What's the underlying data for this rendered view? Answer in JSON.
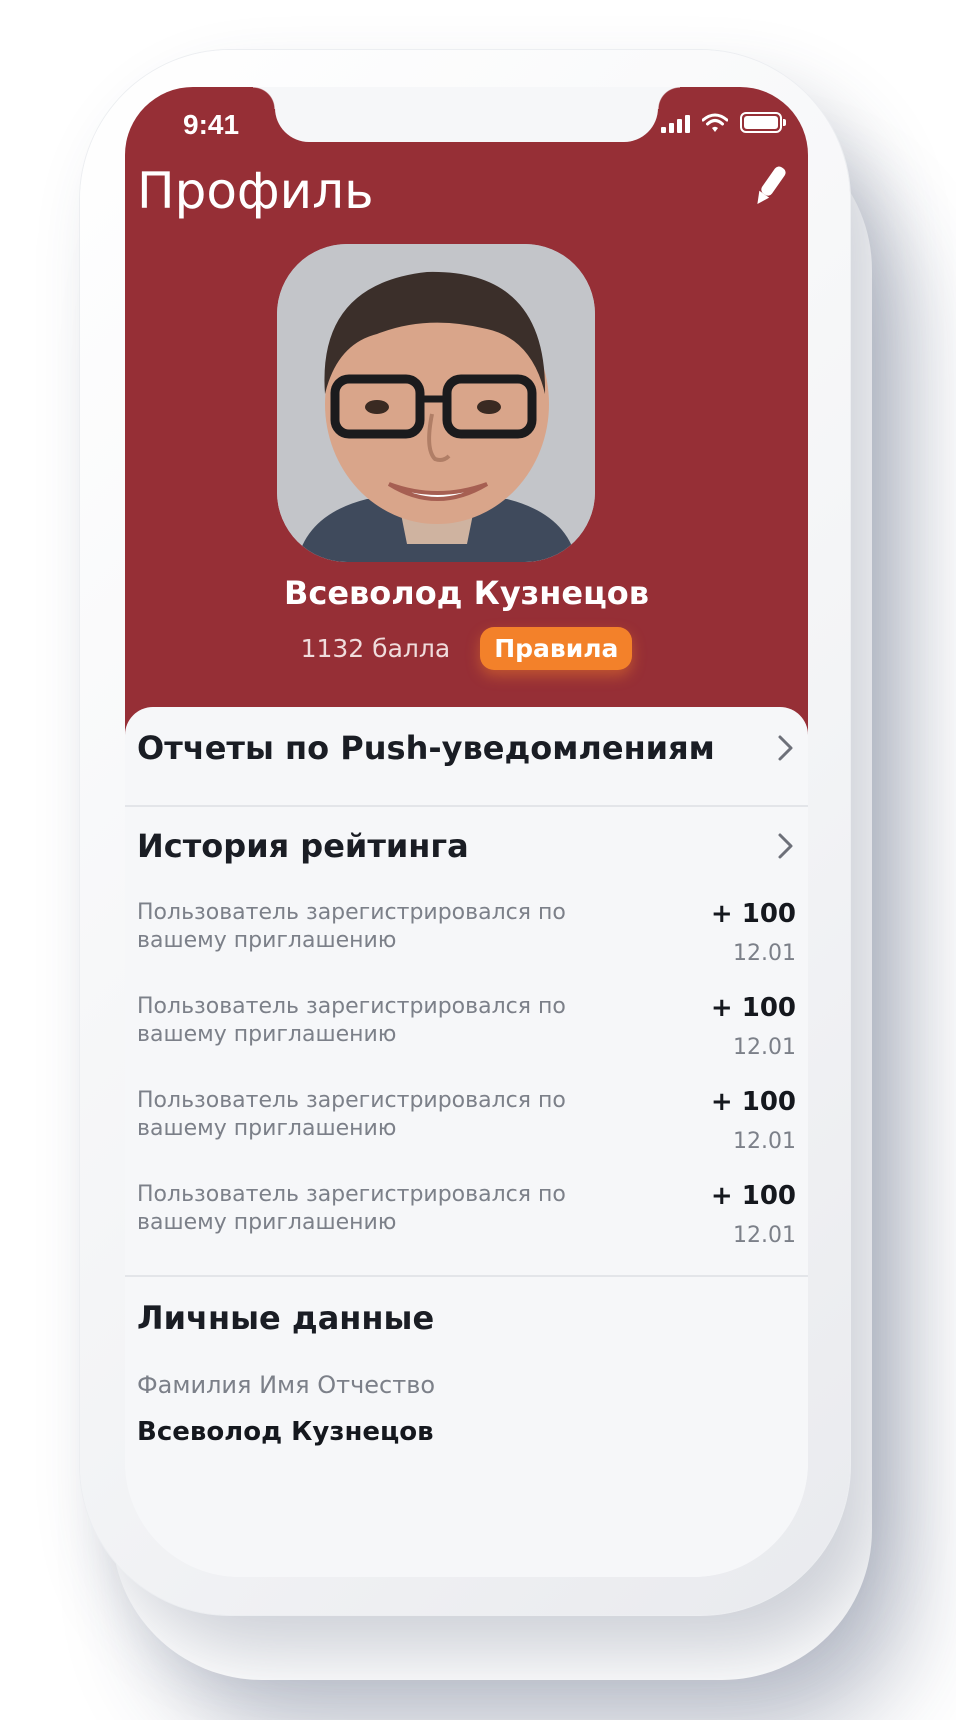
{
  "status_bar": {
    "time": "9:41"
  },
  "header": {
    "title": "Профиль",
    "edit_icon": "pencil-icon",
    "background": "#962f36"
  },
  "profile": {
    "name": "Всеволод Кузнецов",
    "points": "1132 балла",
    "rules_label": "Правила",
    "rules_color": "#f3812a"
  },
  "sections": {
    "push_reports": "Отчеты по Push-уведомлениям",
    "rating_history": "История рейтинга",
    "personal_data": "Личные данные"
  },
  "history": [
    {
      "text": "Пользователь зарегистрировался по вашему приглашению",
      "points": "+ 100",
      "date": "12.01"
    },
    {
      "text": "Пользователь зарегистрировался по вашему приглашению",
      "points": "+ 100",
      "date": "12.01"
    },
    {
      "text": "Пользователь зарегистрировался по вашему приглашению",
      "points": "+ 100",
      "date": "12.01"
    },
    {
      "text": "Пользователь зарегистрировался по вашему приглашению",
      "points": "+ 100",
      "date": "12.01"
    }
  ],
  "personal": {
    "fio_label": "Фамилия Имя Отчество",
    "fio_value": "Всеволод Кузнецов"
  }
}
